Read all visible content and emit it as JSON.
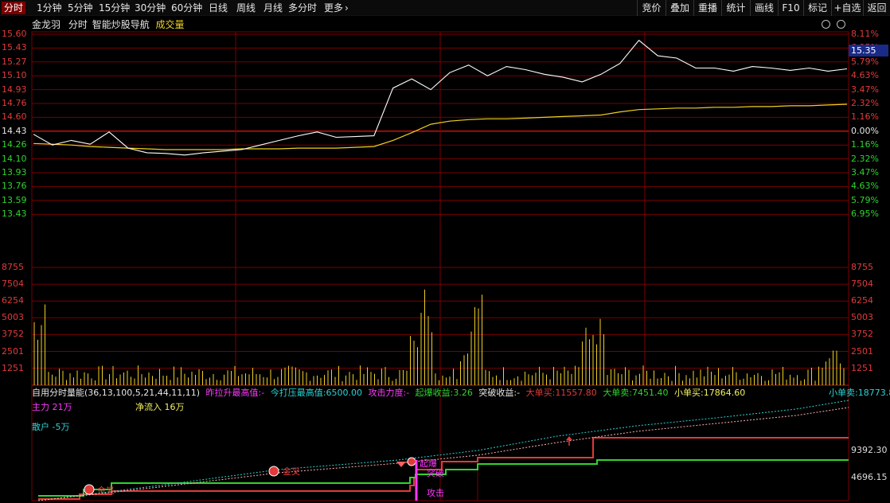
{
  "toolbar": {
    "tabs": [
      "分时",
      "1分钟",
      "5分钟",
      "15分钟",
      "30分钟",
      "60分钟",
      "日线",
      "周线",
      "月线",
      "多分时",
      "更多"
    ],
    "more_arrow": "›",
    "right_buttons": [
      "竞价",
      "叠加",
      "重播",
      "统计",
      "画线",
      "F10",
      "标记",
      "+自选",
      "返回"
    ]
  },
  "header": {
    "stock_name": "金龙羽",
    "view": "分时",
    "nav": "智能炒股导航",
    "volume": "成交量"
  },
  "price_labels": [
    "15.60",
    "15.43",
    "15.27",
    "15.10",
    "14.93",
    "14.76",
    "14.60",
    "14.43",
    "14.26",
    "14.10",
    "13.93",
    "13.76",
    "13.59",
    "13.43"
  ],
  "pct_labels": [
    "8.11%",
    "6.95%",
    "5.79%",
    "4.63%",
    "3.47%",
    "2.32%",
    "1.16%",
    "0.00%",
    "1.16%",
    "2.32%",
    "3.47%",
    "4.63%",
    "5.79%",
    "6.95%"
  ],
  "current_price": "15.35",
  "vol_labels": [
    "8755",
    "7504",
    "6254",
    "5003",
    "3752",
    "2501",
    "1251"
  ],
  "indicator": {
    "name": "自用分时量能",
    "params": "(36,13,100,5,21,44,11,11)",
    "f1_label": "昨拉升最高值:",
    "f1_value": "-",
    "f2_label": "今打压最高值:",
    "f2_value": "6500.00",
    "f3_label": "攻击力度:",
    "f3_value": "-",
    "f4_label": "起爆收益:",
    "f4_value": "3.26",
    "f5_label": "突破收益:",
    "f5_value": "-",
    "f6_label": "大单买:",
    "f6_value": "11557.80",
    "f7_label": "大单卖:",
    "f7_value": "7451.40",
    "f8_label": "小单买:",
    "f8_value": "17864.60",
    "f9_label": "小单卖:",
    "f9_value": "18773.80",
    "zhuli": "主力 21万",
    "jingliuru": "净流入 16万",
    "sanhu": "散户 -5万",
    "scale_hi": "9392.30",
    "scale_lo": "4696.15",
    "tag_jincha": "金叉",
    "tag_jincha2": "金叉",
    "tag_qibao": "起爆",
    "tag_tupo": "突破",
    "tag_gongji": "攻击"
  },
  "chart_data": {
    "type": "line",
    "title": "金龙羽 分时",
    "prev_close": 14.43,
    "ylim": [
      13.26,
      15.6
    ],
    "price_series_approx": [
      14.3,
      14.16,
      14.22,
      14.17,
      14.33,
      14.12,
      14.06,
      14.05,
      14.03,
      14.06,
      14.08,
      14.1,
      14.16,
      14.22,
      14.28,
      14.33,
      14.26,
      14.27,
      14.28,
      14.9,
      15.02,
      14.88,
      15.1,
      15.2,
      15.06,
      15.18,
      15.14,
      15.08,
      15.04,
      14.98,
      15.08,
      15.22,
      15.52,
      15.32,
      15.29,
      15.16,
      15.16,
      15.12,
      15.18,
      15.16,
      15.13,
      15.16,
      15.12,
      15.15
    ],
    "avg_series_approx": [
      14.18,
      14.17,
      14.16,
      14.14,
      14.13,
      14.12,
      14.11,
      14.1,
      14.1,
      14.1,
      14.1,
      14.11,
      14.11,
      14.11,
      14.12,
      14.12,
      14.12,
      14.13,
      14.14,
      14.22,
      14.32,
      14.43,
      14.47,
      14.49,
      14.5,
      14.5,
      14.51,
      14.52,
      14.53,
      14.54,
      14.55,
      14.59,
      14.62,
      14.63,
      14.64,
      14.64,
      14.65,
      14.65,
      14.66,
      14.66,
      14.67,
      14.67,
      14.68,
      14.69
    ]
  },
  "colors": {
    "grid": "#7a0000",
    "up": "#e23a3a",
    "down": "#2fd42f",
    "price_line": "#ffffff",
    "avg_line": "#f0d020",
    "cyan": "#2ad4d4",
    "magenta": "#ff39ff",
    "yellow": "#f4f060"
  }
}
